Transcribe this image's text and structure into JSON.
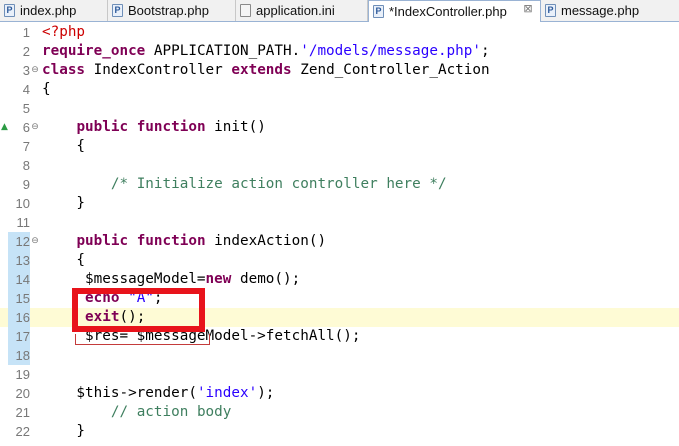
{
  "tabs": [
    {
      "label": "index.php",
      "icon": "P",
      "active": false
    },
    {
      "label": "Bootstrap.php",
      "icon": "P",
      "active": false
    },
    {
      "label": "application.ini",
      "icon": "",
      "active": false
    },
    {
      "label": "*IndexController.php",
      "icon": "P",
      "active": true,
      "close": "⊠"
    },
    {
      "label": "message.php",
      "icon": "P",
      "active": false
    }
  ],
  "lines": [
    {
      "n": "1",
      "tokens": [
        {
          "t": "<?php",
          "c": "php"
        }
      ]
    },
    {
      "n": "2",
      "tokens": [
        {
          "t": "require_once",
          "c": "kw"
        },
        {
          "t": " APPLICATION_PATH.",
          "c": ""
        },
        {
          "t": "'/models/message.php'",
          "c": "str"
        },
        {
          "t": ";",
          "c": ""
        }
      ]
    },
    {
      "n": "3",
      "fold": "⊖",
      "tokens": [
        {
          "t": "class",
          "c": "kw"
        },
        {
          "t": " IndexController ",
          "c": ""
        },
        {
          "t": "extends",
          "c": "kw"
        },
        {
          "t": " Zend_Controller_Action",
          "c": ""
        }
      ]
    },
    {
      "n": "4",
      "tokens": [
        {
          "t": "{",
          "c": ""
        }
      ]
    },
    {
      "n": "5",
      "tokens": []
    },
    {
      "n": "6",
      "fold": "⊖",
      "marker": "▲",
      "tokens": [
        {
          "t": "    ",
          "c": ""
        },
        {
          "t": "public",
          "c": "kw"
        },
        {
          "t": " ",
          "c": ""
        },
        {
          "t": "function",
          "c": "kw"
        },
        {
          "t": " init()",
          "c": ""
        }
      ]
    },
    {
      "n": "7",
      "tokens": [
        {
          "t": "    {",
          "c": ""
        }
      ]
    },
    {
      "n": "8",
      "tokens": []
    },
    {
      "n": "9",
      "tokens": [
        {
          "t": "        ",
          "c": ""
        },
        {
          "t": "/* Initialize action controller here */",
          "c": "cmt"
        }
      ]
    },
    {
      "n": "10",
      "tokens": [
        {
          "t": "    }",
          "c": ""
        }
      ]
    },
    {
      "n": "11",
      "tokens": []
    },
    {
      "n": "12",
      "fold": "⊖",
      "blue": true,
      "tokens": [
        {
          "t": "    ",
          "c": ""
        },
        {
          "t": "public",
          "c": "kw"
        },
        {
          "t": " ",
          "c": ""
        },
        {
          "t": "function",
          "c": "kw"
        },
        {
          "t": " indexAction()",
          "c": ""
        }
      ]
    },
    {
      "n": "13",
      "blue": true,
      "tokens": [
        {
          "t": "    {",
          "c": ""
        }
      ]
    },
    {
      "n": "14",
      "blue": true,
      "tokens": [
        {
          "t": "     $messageModel=",
          "c": ""
        },
        {
          "t": "new",
          "c": "kw"
        },
        {
          "t": " demo();",
          "c": ""
        }
      ]
    },
    {
      "n": "15",
      "blue": true,
      "tokens": [
        {
          "t": "     ",
          "c": ""
        },
        {
          "t": "echo",
          "c": "kw"
        },
        {
          "t": " ",
          "c": ""
        },
        {
          "t": "\"A\"",
          "c": "str"
        },
        {
          "t": ";",
          "c": ""
        }
      ]
    },
    {
      "n": "16",
      "blue": true,
      "hl": true,
      "tokens": [
        {
          "t": "     ",
          "c": ""
        },
        {
          "t": "exit",
          "c": "kw"
        },
        {
          "t": "();",
          "c": ""
        }
      ]
    },
    {
      "n": "17",
      "blue": true,
      "tokens": [
        {
          "t": "     $res= $messageModel->fetchAll();",
          "c": ""
        }
      ]
    },
    {
      "n": "18",
      "blue": true,
      "tokens": []
    },
    {
      "n": "19",
      "tokens": []
    },
    {
      "n": "20",
      "tokens": [
        {
          "t": "    $this->render(",
          "c": ""
        },
        {
          "t": "'index'",
          "c": "str"
        },
        {
          "t": ");",
          "c": ""
        }
      ]
    },
    {
      "n": "21",
      "tokens": [
        {
          "t": "        ",
          "c": ""
        },
        {
          "t": "// action body",
          "c": "cmt"
        }
      ]
    },
    {
      "n": "22",
      "tokens": [
        {
          "t": "    }",
          "c": ""
        }
      ]
    }
  ],
  "colors": {
    "keyword": "#7f0055",
    "string": "#2a00ff",
    "comment": "#3f7f5f",
    "php_tag": "#cc0000",
    "current_line": "#fefbd5",
    "annotation": "#e8131b"
  }
}
